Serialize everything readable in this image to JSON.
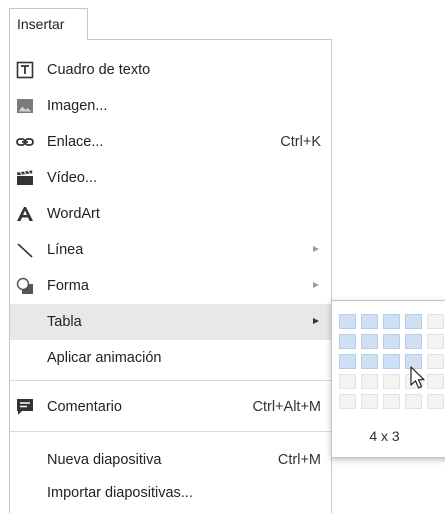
{
  "menubar": {
    "insert_label": "Insertar"
  },
  "menu": {
    "items": [
      {
        "label": "Cuadro de texto",
        "icon": "text-box-icon"
      },
      {
        "label": "Imagen...",
        "icon": "image-icon"
      },
      {
        "label": "Enlace...",
        "icon": "link-icon",
        "shortcut": "Ctrl+K"
      },
      {
        "label": "Vídeo...",
        "icon": "video-icon"
      },
      {
        "label": "WordArt",
        "icon": "wordart-icon"
      },
      {
        "label": "Línea",
        "icon": "line-icon",
        "submenu": true
      },
      {
        "label": "Forma",
        "icon": "shape-icon",
        "submenu": true
      },
      {
        "label": "Tabla",
        "submenu": true,
        "highlighted": true
      },
      {
        "label": "Aplicar animación"
      },
      {
        "label": "Comentario",
        "icon": "comment-icon",
        "shortcut": "Ctrl+Alt+M"
      },
      {
        "label": "Nueva diapositiva",
        "shortcut": "Ctrl+M"
      },
      {
        "label": "Importar diapositivas..."
      }
    ]
  },
  "table_grid": {
    "selected_columns": 4,
    "selected_rows": 3,
    "size_label": "4 x 3"
  },
  "colors": {
    "highlight": "#e8e8e8",
    "grid_selected": "#cfe0f4",
    "grid_unselected": "#f3f3f3",
    "border": "#c6c6c6"
  }
}
